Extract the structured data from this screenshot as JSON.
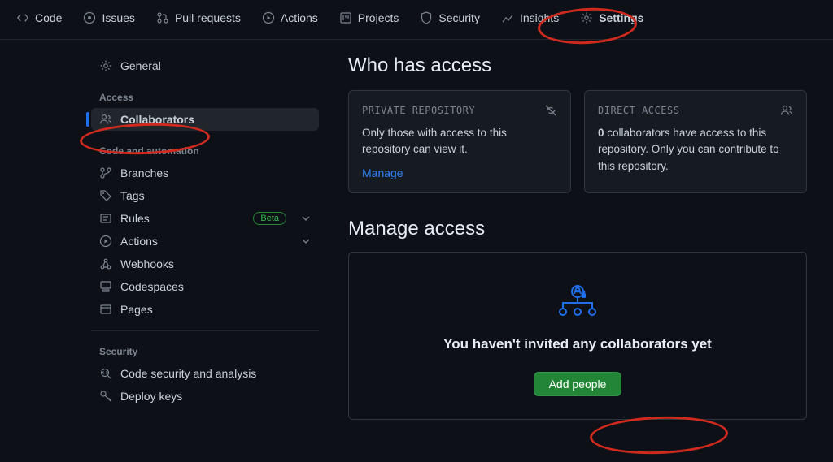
{
  "topnav": {
    "code": "Code",
    "issues": "Issues",
    "pull_requests": "Pull requests",
    "actions": "Actions",
    "projects": "Projects",
    "security": "Security",
    "insights": "Insights",
    "settings": "Settings"
  },
  "sidebar": {
    "general": "General",
    "section_access": "Access",
    "collaborators": "Collaborators",
    "section_code": "Code and automation",
    "branches": "Branches",
    "tags": "Tags",
    "rules": "Rules",
    "rules_pill": "Beta",
    "actions": "Actions",
    "webhooks": "Webhooks",
    "codespaces": "Codespaces",
    "pages": "Pages",
    "section_security": "Security",
    "codesecurity": "Code security and analysis",
    "deploykeys": "Deploy keys"
  },
  "main": {
    "who_title": "Who has access",
    "box_private_title": "PRIVATE REPOSITORY",
    "box_private_body": "Only those with access to this repository can view it.",
    "box_private_link": "Manage",
    "box_direct_title": "DIRECT ACCESS",
    "box_direct_count": "0",
    "box_direct_body_rest": " collaborators have access to this repository. Only you can contribute to this repository.",
    "manage_title": "Manage access",
    "empty_message": "You haven't invited any collaborators yet",
    "add_button": "Add people"
  }
}
